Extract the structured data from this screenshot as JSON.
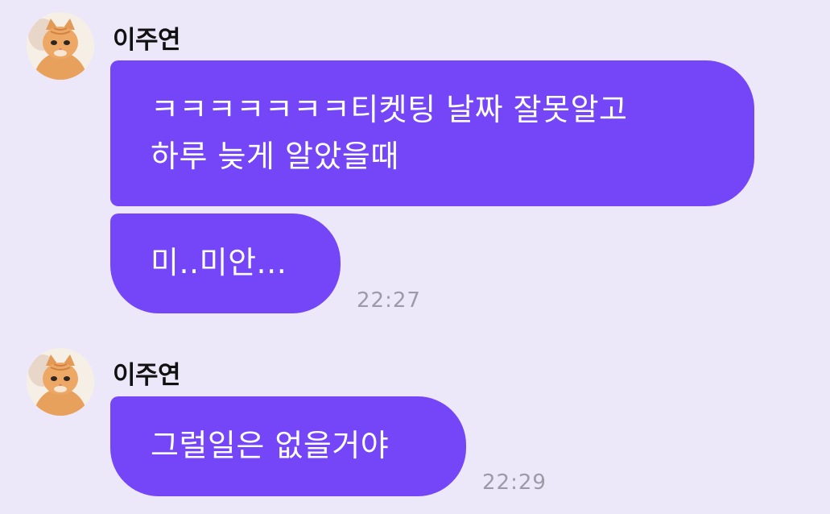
{
  "chat": {
    "messages": [
      {
        "sender": "이주연",
        "lines": [
          "ㅋㅋㅋㅋㅋㅋㅋ티켓팅 날짜 잘못알고",
          "하루 늦게 알았을때"
        ],
        "time": ""
      },
      {
        "sender": "",
        "lines": [
          "미..미안..."
        ],
        "time": "22:27"
      },
      {
        "sender": "이주연",
        "lines": [
          "그럴일은 없을거야"
        ],
        "time": "22:29"
      }
    ]
  },
  "colors": {
    "background": "#ECE8FA",
    "bubble": "#7446F8",
    "bubble_text": "#FFFFFF",
    "name_text": "#111111",
    "time_text": "#9D99A8"
  },
  "icons": {
    "avatar": "orange-tabby-cat-avatar-icon"
  }
}
